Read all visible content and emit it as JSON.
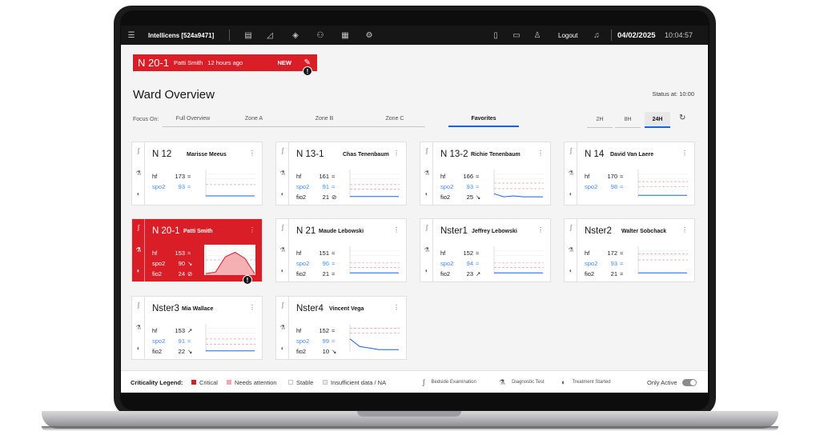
{
  "app": {
    "title": "Intellicens [524a9471]",
    "logout_label": "Logout",
    "date": "04/02/2025",
    "time": "10:04:57"
  },
  "alert": {
    "bed": "N 20-1",
    "patient": "Patti Smith",
    "time_ago": "12 hours ago",
    "badge": "NEW"
  },
  "page": {
    "title": "Ward Overview",
    "status": "Status at: 10:00",
    "focus_label": "Focus On:"
  },
  "focus_tabs": [
    {
      "label": "Full Overview",
      "active": false
    },
    {
      "label": "Zone A",
      "active": false
    },
    {
      "label": "Zone B",
      "active": false
    },
    {
      "label": "Zone C",
      "active": false
    },
    {
      "label": "Favorites",
      "active": true
    }
  ],
  "time_tabs": [
    {
      "label": "2H",
      "active": false
    },
    {
      "label": "8H",
      "active": false
    },
    {
      "label": "24H",
      "active": true
    }
  ],
  "colors": {
    "critical": "#da1e28",
    "needs_attention": "#f3a7ab",
    "stable": "#ffffff",
    "insufficient": "#e8e8e8",
    "accent": "#0f62fe",
    "spo2": "#4589ff"
  },
  "beds": [
    {
      "bed": "N 12",
      "patient": "Marisse Meeus",
      "critical": false,
      "vitals": [
        {
          "label": "hf",
          "value": "173",
          "trend": "≈",
          "blue": false
        },
        {
          "label": "spo2",
          "value": "93",
          "trend": "≈",
          "blue": true
        }
      ],
      "spark": {
        "dash": [
          0.55
        ],
        "line": [
          0.92,
          0.92,
          0.92,
          0.92,
          0.92,
          0.92
        ]
      }
    },
    {
      "bed": "N 13-1",
      "patient": "Chas Tenenbaum",
      "critical": false,
      "vitals": [
        {
          "label": "hf",
          "value": "161",
          "trend": "≈",
          "blue": false
        },
        {
          "label": "spo2",
          "value": "91",
          "trend": "≈",
          "blue": true
        },
        {
          "label": "fio2",
          "value": "21",
          "trend": "⊘",
          "blue": false
        }
      ],
      "spark": {
        "dash": [
          0.55,
          0.7
        ],
        "line": [
          0.94,
          0.94,
          0.94,
          0.94,
          0.94,
          0.94
        ]
      }
    },
    {
      "bed": "N 13-2",
      "patient": "Richie Tenenbaum",
      "critical": false,
      "vitals": [
        {
          "label": "hf",
          "value": "166",
          "trend": "≈",
          "blue": false
        },
        {
          "label": "spo2",
          "value": "93",
          "trend": "≈",
          "blue": true
        },
        {
          "label": "fio2",
          "value": "25",
          "trend": "↘",
          "blue": false
        }
      ],
      "spark": {
        "dash": [
          0.5,
          0.68
        ],
        "line": [
          0.85,
          0.95,
          0.92,
          0.95,
          0.95,
          0.95
        ]
      }
    },
    {
      "bed": "N 14",
      "patient": "David Van Laere",
      "critical": false,
      "vitals": [
        {
          "label": "hf",
          "value": "170",
          "trend": "≈",
          "blue": false
        },
        {
          "label": "spo2",
          "value": "98",
          "trend": "≈",
          "blue": true
        }
      ],
      "spark": {
        "dash": [
          0.45,
          0.62
        ],
        "line": [
          0.9,
          0.9,
          0.9,
          0.9,
          0.9,
          0.9
        ]
      }
    },
    {
      "bed": "N 20-1",
      "patient": "Patti Smith",
      "critical": true,
      "vitals": [
        {
          "label": "hf",
          "value": "153",
          "trend": "≈",
          "blue": false
        },
        {
          "label": "spo2",
          "value": "90",
          "trend": "↘",
          "blue": true
        },
        {
          "label": "fio2",
          "value": "24",
          "trend": "⊘",
          "blue": false
        }
      ],
      "spark": {
        "dash": [
          0.5
        ],
        "line": [
          0.95,
          0.9,
          0.4,
          0.25,
          0.45,
          0.95
        ]
      }
    },
    {
      "bed": "N 21",
      "patient": "Maude Lebowski",
      "critical": false,
      "vitals": [
        {
          "label": "hf",
          "value": "151",
          "trend": "≈",
          "blue": false
        },
        {
          "label": "spo2",
          "value": "96",
          "trend": "≈",
          "blue": true
        },
        {
          "label": "fio2",
          "value": "21",
          "trend": "≈",
          "blue": false
        }
      ],
      "spark": {
        "dash": [
          0.6,
          0.75
        ],
        "line": [
          0.93,
          0.93,
          0.93,
          0.93,
          0.93,
          0.93
        ]
      }
    },
    {
      "bed": "Nster1",
      "patient": "Jeffrey Lebowski",
      "critical": false,
      "vitals": [
        {
          "label": "hf",
          "value": "152",
          "trend": "≈",
          "blue": false
        },
        {
          "label": "spo2",
          "value": "94",
          "trend": "≈",
          "blue": true
        },
        {
          "label": "fio2",
          "value": "23",
          "trend": "↗",
          "blue": false
        }
      ],
      "spark": {
        "dash": [
          0.6,
          0.75
        ],
        "line": [
          0.93,
          0.93,
          0.93,
          0.93,
          0.93,
          0.93
        ]
      }
    },
    {
      "bed": "Nster2",
      "patient": "Walter Sobchack",
      "critical": false,
      "vitals": [
        {
          "label": "hf",
          "value": "172",
          "trend": "≈",
          "blue": false
        },
        {
          "label": "spo2",
          "value": "93",
          "trend": "≈",
          "blue": true
        },
        {
          "label": "fio2",
          "value": "21",
          "trend": "≈",
          "blue": false
        }
      ],
      "spark": {
        "dash": [
          0.3,
          0.5
        ],
        "line": [
          0.93,
          0.93,
          0.93,
          0.93,
          0.93,
          0.93
        ]
      }
    },
    {
      "bed": "Nster3",
      "patient": "Mia Wallace",
      "critical": false,
      "vitals": [
        {
          "label": "hf",
          "value": "153",
          "trend": "↗",
          "blue": false
        },
        {
          "label": "spo2",
          "value": "91",
          "trend": "≈",
          "blue": true
        },
        {
          "label": "fio2",
          "value": "22",
          "trend": "↘",
          "blue": false
        }
      ],
      "spark": {
        "dash": [
          0.55,
          0.72
        ],
        "line": [
          0.94,
          0.94,
          0.94,
          0.94,
          0.94,
          0.94
        ]
      }
    },
    {
      "bed": "Nster4",
      "patient": "Vincent Vega",
      "critical": false,
      "vitals": [
        {
          "label": "hf",
          "value": "152",
          "trend": "≈",
          "blue": false
        },
        {
          "label": "spo2",
          "value": "99",
          "trend": "≈",
          "blue": true
        },
        {
          "label": "fio2",
          "value": "10",
          "trend": "↘",
          "blue": false
        }
      ],
      "spark": {
        "dash": [
          0.35,
          0.2
        ],
        "line": [
          0.55,
          0.8,
          0.85,
          0.9,
          0.9,
          0.9
        ]
      }
    }
  ],
  "legend": {
    "title": "Criticality Legend:",
    "critical": "Critical",
    "needs_attention": "Needs attention",
    "stable": "Stable",
    "insufficient": "Insufficient data / NA",
    "bedside": "Bedside Examination",
    "diagnostic": "Diagnostic Test",
    "treatment": "Treatment Started",
    "only_active": "Only Active"
  }
}
